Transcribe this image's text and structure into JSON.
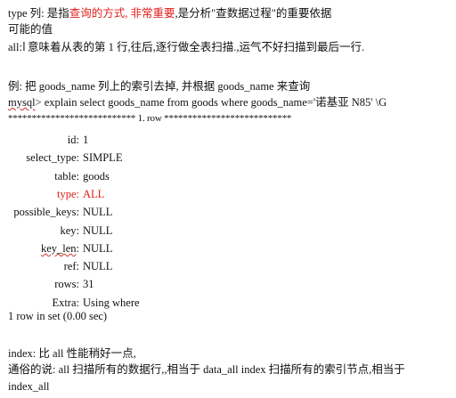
{
  "intro": {
    "line1_prefix": "type 列: 是指",
    "line1_highlight": "查询的方式, 非常重要",
    "line1_suffix": ",是分析\"查数据过程\"的重要依据",
    "line2": "可能的值",
    "line3_prefix": "all:",
    "line3_suffix": "意味着从表的第 1 行,往后,逐行做全表扫描.,运气不好扫描到最后一行."
  },
  "example": {
    "title": "例: 把 goods_name 列上的索引去掉, 并根据 goods_name 来查询",
    "mysql_prompt": "mysql",
    "query": "> explain select goods_name from goods where goods_name='诺基亚 N85' \\G",
    "separator": "*************************** 1. row ***************************"
  },
  "explain_rows": [
    {
      "key": "id",
      "value": "1",
      "highlight": false
    },
    {
      "key": "select_type",
      "value": "SIMPLE",
      "highlight": false
    },
    {
      "key": "table",
      "value": "goods",
      "highlight": false
    },
    {
      "key": "type",
      "value": "ALL",
      "highlight": true
    },
    {
      "key": "possible_keys",
      "value": "NULL",
      "highlight": false
    },
    {
      "key": "key",
      "value": "NULL",
      "highlight": false
    },
    {
      "key": "key_len",
      "value": "NULL",
      "highlight": false
    },
    {
      "key": "ref",
      "value": "NULL",
      "highlight": false
    },
    {
      "key": "rows",
      "value": "31",
      "highlight": false
    },
    {
      "key": "Extra",
      "value": "Using where",
      "highlight": false
    }
  ],
  "result_summary": "1 row in set (0.00 sec)",
  "index_section": {
    "line1": "index: 比 all 性能稍好一点,",
    "line2": "通俗的说: all 扫描所有的数据行,,相当于 data_all   index 扫描所有的索引节点,相当于",
    "line3": "index_all"
  },
  "colors": {
    "highlight": "#e0201a",
    "text": "#111111"
  }
}
